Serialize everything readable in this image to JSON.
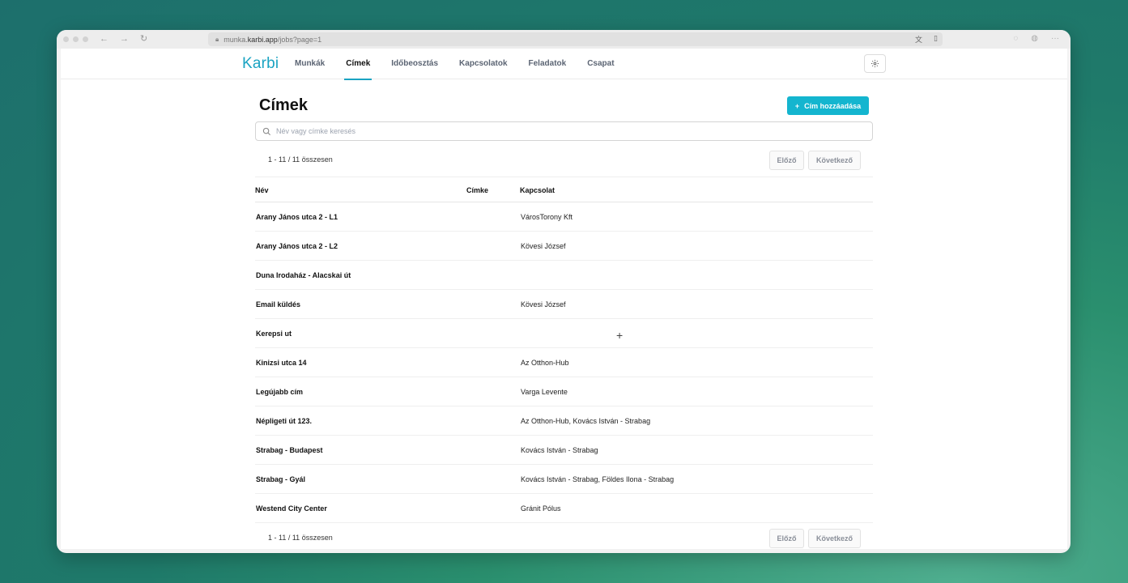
{
  "browser": {
    "url_prefix": "munka.",
    "url_domain": "karbi.app",
    "url_path": "/jobs?page=1"
  },
  "nav": {
    "logo": "Karbi",
    "items": [
      {
        "label": "Munkák"
      },
      {
        "label": "Címek"
      },
      {
        "label": "Időbeosztás"
      },
      {
        "label": "Kapcsolatok"
      },
      {
        "label": "Feladatok"
      },
      {
        "label": "Csapat"
      }
    ],
    "active_index": 1
  },
  "page": {
    "title": "Címek",
    "add_button": "Cím hozzáadása",
    "search_placeholder": "Név vagy címke keresés"
  },
  "pagination": {
    "summary": "1 - 11 / 11 összesen",
    "prev": "Előző",
    "next": "Következő"
  },
  "table": {
    "headers": {
      "name": "Név",
      "tag": "Címke",
      "contact": "Kapcsolat"
    },
    "rows": [
      {
        "name": "Arany János utca 2 - L1",
        "contact": "VárosTorony Kft"
      },
      {
        "name": "Arany János utca 2 - L2",
        "contact": "Kövesi József"
      },
      {
        "name": "Duna Irodaház - Alacskai út",
        "contact": ""
      },
      {
        "name": "Email küldés",
        "contact": "Kövesi József"
      },
      {
        "name": "Kerepsi ut",
        "contact": ""
      },
      {
        "name": "Kinizsi utca 14",
        "contact": "Az Otthon-Hub"
      },
      {
        "name": "Legújabb cím",
        "contact": "Varga Levente"
      },
      {
        "name": "Népligeti út 123.",
        "contact": "Az Otthon-Hub, Kovács István - Strabag"
      },
      {
        "name": "Strabag - Budapest",
        "contact": "Kovács István - Strabag"
      },
      {
        "name": "Strabag - Gyál",
        "contact": "Kovács István - Strabag, Földes Ilona - Strabag"
      },
      {
        "name": "Westend City Center",
        "contact": "Gránit Pólus"
      }
    ]
  },
  "colors": {
    "accent": "#14b5cf",
    "logo": "#1aa3c2"
  }
}
